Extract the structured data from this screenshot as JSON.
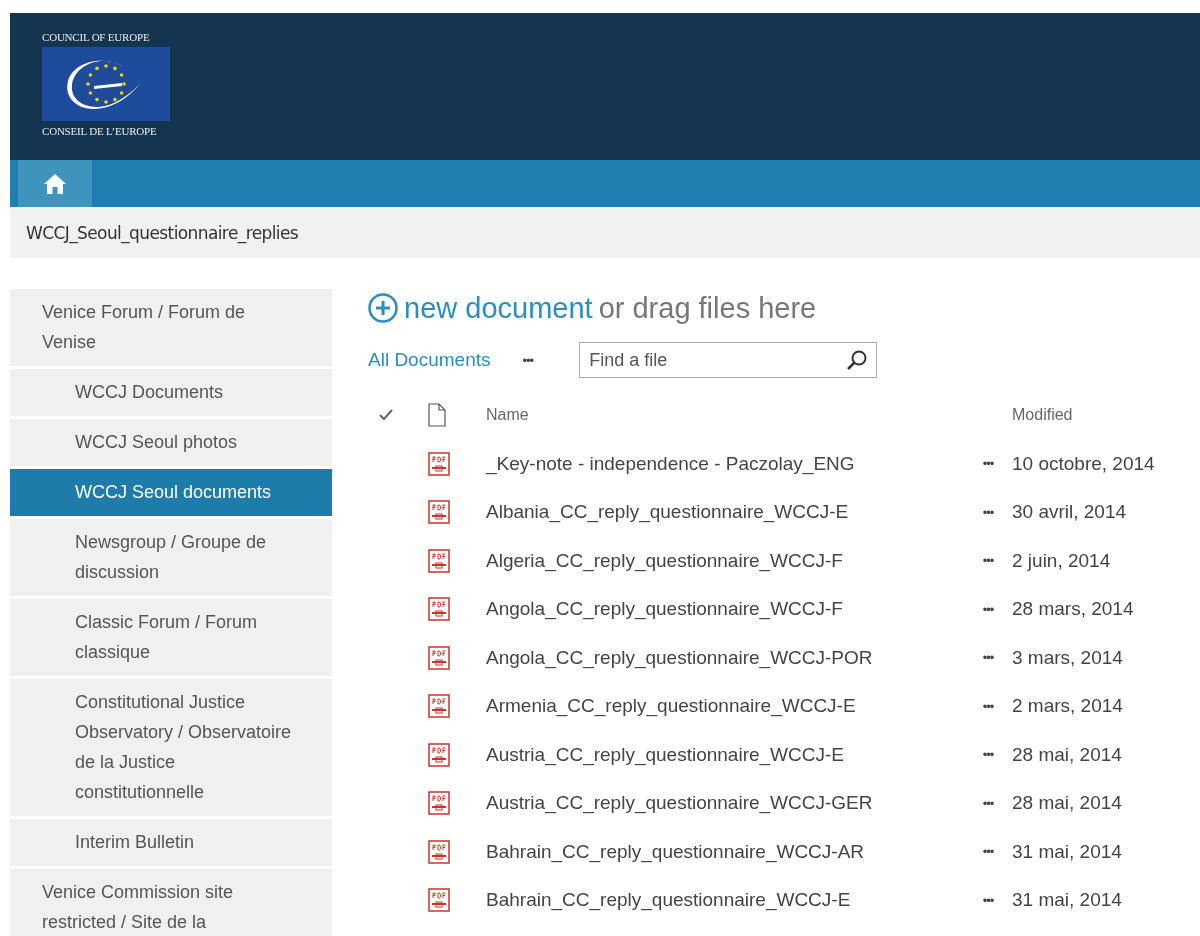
{
  "header": {
    "logo_top": "COUNCIL OF EUROPE",
    "logo_bottom": "CONSEIL DE L’EUROPE"
  },
  "breadcrumb": "WCCJ_Seoul_questionnaire_replies",
  "sidebar": {
    "items": [
      {
        "label": "Venice Forum / Forum de Venise",
        "selected": false,
        "children": [
          {
            "label": "WCCJ Documents",
            "selected": false
          },
          {
            "label": "WCCJ Seoul photos",
            "selected": false
          },
          {
            "label": "WCCJ Seoul documents",
            "selected": true
          },
          {
            "label": "Newsgroup / Groupe de discussion",
            "selected": false
          },
          {
            "label": "Classic Forum / Forum classique",
            "selected": false
          },
          {
            "label": "Constitutional Justice Observatory / Observatoire de la Justice constitutionnelle",
            "selected": false
          },
          {
            "label": "Interim Bulletin",
            "selected": false
          }
        ]
      },
      {
        "label": "Venice Commission site restricted / Site de la",
        "selected": false
      }
    ]
  },
  "new_document": {
    "link": "new document",
    "rest": "or drag files here"
  },
  "views": {
    "current": "All Documents",
    "more": "•••"
  },
  "search": {
    "placeholder": "Find a file"
  },
  "table": {
    "columns": [
      "Name",
      "Modified"
    ],
    "rows": [
      {
        "name": "_Key-note - independence - Paczolay_ENG",
        "more": "•••",
        "modified": "10 octobre, 2014"
      },
      {
        "name": "Albania_CC_reply_questionnaire_WCCJ-E",
        "more": "•••",
        "modified": "30 avril, 2014"
      },
      {
        "name": "Algeria_CC_reply_questionnaire_WCCJ-F",
        "more": "•••",
        "modified": "2 juin, 2014"
      },
      {
        "name": "Angola_CC_reply_questionnaire_WCCJ-F",
        "more": "•••",
        "modified": "28 mars, 2014"
      },
      {
        "name": "Angola_CC_reply_questionnaire_WCCJ-POR",
        "more": "•••",
        "modified": "3 mars, 2014"
      },
      {
        "name": "Armenia_CC_reply_questionnaire_WCCJ-E",
        "more": "•••",
        "modified": "2 mars, 2014"
      },
      {
        "name": "Austria_CC_reply_questionnaire_WCCJ-E",
        "more": "•••",
        "modified": "28 mai, 2014"
      },
      {
        "name": "Austria_CC_reply_questionnaire_WCCJ-GER",
        "more": "•••",
        "modified": "28 mai, 2014"
      },
      {
        "name": "Bahrain_CC_reply_questionnaire_WCCJ-AR",
        "more": "•••",
        "modified": "31 mai, 2014"
      },
      {
        "name": "Bahrain_CC_reply_questionnaire_WCCJ-E",
        "more": "•••",
        "modified": "31 mai, 2014"
      }
    ]
  }
}
